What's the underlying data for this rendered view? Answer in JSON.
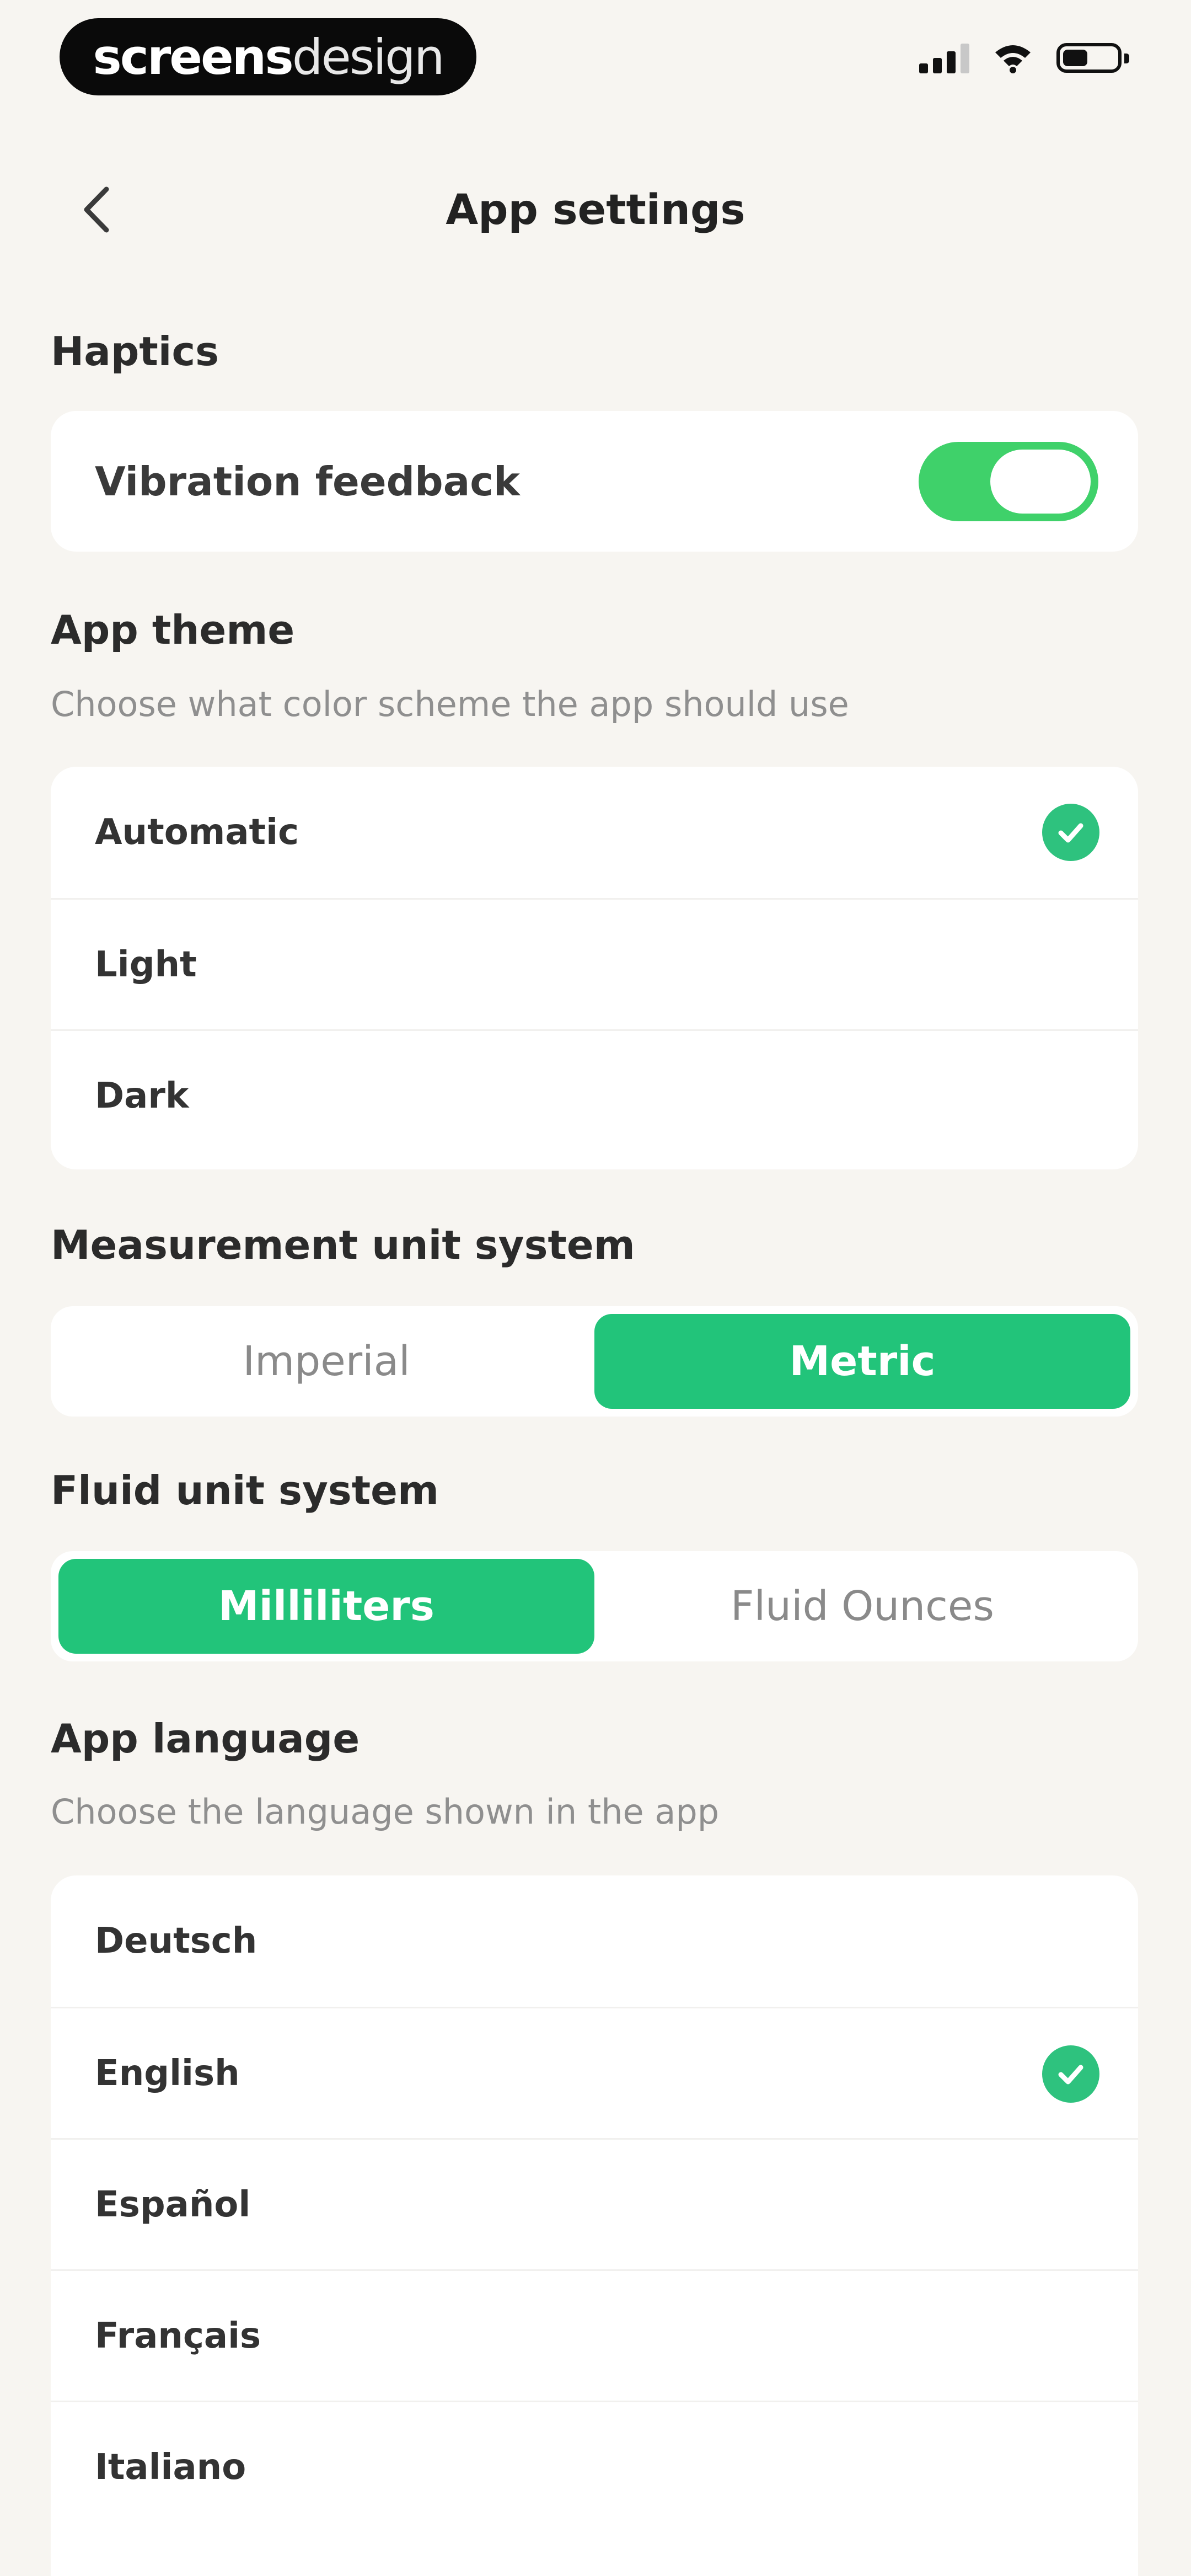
{
  "status_bar": {
    "brand_bold": "screens",
    "brand_light": "design"
  },
  "header": {
    "title": "App settings",
    "back_icon": "chevron-left-icon"
  },
  "haptics": {
    "section_title": "Haptics",
    "vibration_label": "Vibration feedback",
    "vibration_on": true
  },
  "theme": {
    "section_title": "App theme",
    "subtitle": "Choose what color scheme the app should use",
    "options": [
      "Automatic",
      "Light",
      "Dark"
    ],
    "selected": "Automatic"
  },
  "measurement": {
    "section_title": "Measurement unit system",
    "options": [
      "Imperial",
      "Metric"
    ],
    "selected": "Metric"
  },
  "fluid": {
    "section_title": "Fluid unit system",
    "options": [
      "Milliliters",
      "Fluid Ounces"
    ],
    "selected": "Milliliters"
  },
  "language": {
    "section_title": "App language",
    "subtitle": "Choose the language shown in the app",
    "options": [
      "Deutsch",
      "English",
      "Español",
      "Français",
      "Italiano"
    ],
    "selected": "English"
  },
  "colors": {
    "accent": "#22c47a",
    "toggle_on": "#3fd16a",
    "background": "#f7f5f1"
  }
}
